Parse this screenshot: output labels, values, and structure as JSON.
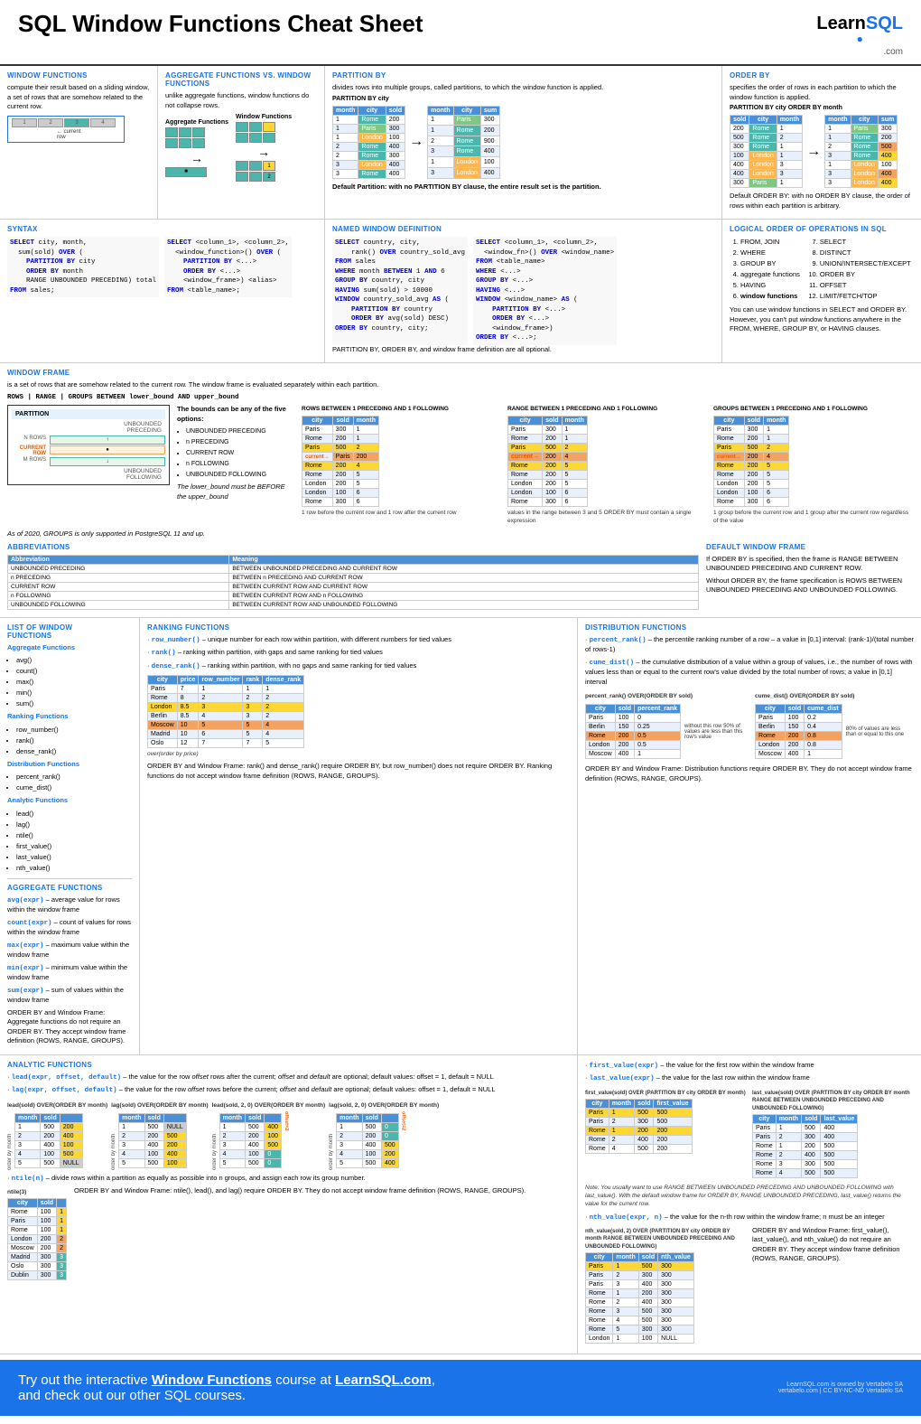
{
  "header": {
    "title": "SQL Window Functions Cheat Sheet",
    "logo_learn": "Learn",
    "logo_sql": "SQL",
    "logo_dot": "●",
    "logo_com": ".com"
  },
  "window_functions": {
    "title": "WINDOW FUNCTIONS",
    "desc": "compute their result based on a sliding window, a set of rows that are somehow related to the current row.",
    "label_current": "current",
    "label_row": "row"
  },
  "agg_vs_window": {
    "title": "AGGREGATE FUNCTIONS VS. WINDOW FUNCTIONS",
    "desc": "unlike aggregate functions, window functions do not collapse rows.",
    "label_agg": "Aggregate Functions",
    "label_win": "Window Functions"
  },
  "partition_by": {
    "title": "PARTITION BY",
    "desc": "divides rows into multiple groups, called partitions, to which the window function is applied.",
    "label_partition": "PARTITION BY city",
    "default_text": "Default Partition: with no PARTITION BY clause, the entire result set is the partition.",
    "table_headers": [
      "month",
      "city",
      "sold"
    ],
    "table_data": [
      [
        "1",
        "Rome",
        "200"
      ],
      [
        "1",
        "Paris",
        "300"
      ],
      [
        "1",
        "London",
        "100"
      ],
      [
        "2",
        "Rome",
        "400"
      ],
      [
        "2",
        "Rome",
        "300"
      ],
      [
        "3",
        "London",
        "400"
      ],
      [
        "3",
        "Rome",
        "400"
      ]
    ],
    "table2_headers": [
      "month",
      "city",
      "sum"
    ],
    "table2_data": [
      [
        "1",
        "Paris",
        "300"
      ],
      [
        "1",
        "Rome",
        "200"
      ],
      [
        "1",
        "London",
        "100"
      ],
      [
        "2",
        "Rome",
        "900"
      ],
      [
        "3",
        "London",
        "400"
      ],
      [
        "3",
        "Rome",
        "400"
      ]
    ]
  },
  "order_by": {
    "title": "ORDER BY",
    "desc": "specifies the order of rows in each partition to which the window function is applied.",
    "label": "PARTITION BY city ORDER BY month",
    "default_text": "Default ORDER BY: with no ORDER BY clause, the order of rows within each partition is arbitrary.",
    "table_headers": [
      "sold",
      "city",
      "month"
    ],
    "table_data": [
      [
        "200",
        "Rome",
        "1"
      ],
      [
        "500",
        "Rome",
        "2"
      ],
      [
        "300",
        "Rome",
        "1"
      ],
      [
        "100",
        "London",
        "1"
      ],
      [
        "400",
        "London",
        "3"
      ],
      [
        "400",
        "London",
        "3"
      ],
      [
        "300",
        "Paris",
        "1"
      ]
    ],
    "table2_headers": [
      "month",
      "city",
      "sum"
    ],
    "table2_data": [
      [
        "1",
        "Paris",
        "300"
      ],
      [
        "1",
        "Rome",
        "200"
      ],
      [
        "2",
        "Rome",
        "500"
      ],
      [
        "3",
        "Rome",
        "400"
      ],
      [
        "1",
        "London",
        "100"
      ],
      [
        "3",
        "London",
        "400"
      ],
      [
        "3",
        "London",
        "400"
      ]
    ]
  },
  "syntax": {
    "title": "SYNTAX",
    "code1": "SELECT city, month,\n  sum(sold) OVER (\n    PARTITION BY city\n    ORDER BY month\n    RANGE UNBOUNDED PRECEDING) total\nFROM sales;",
    "code2": "SELECT <column_1>, <column_2>,\n  <window_function>() OVER (\n    PARTITION BY <...>\n    ORDER BY <...>\n    <window_frame>) <window_column_alias>\nFROM <table_name>;"
  },
  "named_window": {
    "title": "Named Window Definition",
    "code1": "SELECT country, city,\n    rank() OVER country_sold_avg\nFROM sales\nWHERE month BETWEEN 1 AND 6\nGROUP BY country, city\nHAVING sum(sold) > 10000\nWINDOW country_sold_avg AS (\n    PARTITION BY country\n    ORDER BY avg(sold) DESC)\nORDER BY country, city;",
    "code2": "SELECT <column_1>, <column_2>,\n  <window_function>() OVER <window_name>\nFROM <table_name>\nWHERE <...>\nGROUP BY <...>\nHAVING <...>\nWINDOW <window_name> AS (\n    PARTITION BY <...>\n    ORDER BY <...>\n    <window_frame>)\nORDER BY <...>;",
    "note": "PARTITION BY, ORDER BY, and window frame definition are all optional."
  },
  "logical_order": {
    "title": "LOGICAL ORDER OF OPERATIONS IN SQL",
    "items_left": [
      "1.  FROM, JOIN",
      "2.  WHERE",
      "3.  GROUP BY",
      "4.  aggregate functions",
      "5.  HAVING",
      "6.  window functions"
    ],
    "items_right": [
      "7.  SELECT",
      "8.  DISTINCT",
      "9.  UNION/INTERSECT/EXCEPT",
      "10. ORDER BY",
      "11. OFFSET",
      "12. LIMIT/FETCH/TOP"
    ],
    "note": "You can use window functions in SELECT and ORDER BY. However, you can't put window functions anywhere in the FROM, WHERE, GROUP BY, or HAVING clauses."
  },
  "window_frame": {
    "title": "WINDOW FRAME",
    "desc": "is a set of rows that are somehow related to the current row. The window frame is evaluated separately within each partition.",
    "formula": "ROWS | RANGE | GROUPS BETWEEN lower_bound AND upper_bound",
    "labels": {
      "partition": "PARTITION",
      "unbounded_preceding": "UNBOUNDED\nPRECEDING",
      "n_preceding": "N ROWS",
      "current_row": "CURRENT\nROW",
      "m_following": "M ROWS",
      "unbounded_following": "UNBOUNDED\nFOLLOWING"
    },
    "bounds_title": "The bounds can be any of the five options:",
    "bounds": [
      "UNBOUNDED PRECEDING",
      "n PRECEDING",
      "CURRENT ROW",
      "n FOLLOWING",
      "UNBOUNDED FOLLOWING"
    ],
    "lower_note": "The lower_bound must be BEFORE the upper_bound",
    "rows_example_title": "ROWS BETWEEN 1 PRECEDING AND 1 FOLLOWING",
    "range_example_title": "RANGE BETWEEN 1 PRECEDING AND 1 FOLLOWING",
    "groups_example_title": "GROUPS BETWEEN 1 PRECEDING AND 1 FOLLOWING",
    "rows_note": "1 row before the current row and 1 row after the current row",
    "range_note": "values in the range between 3 and 5 ORDER BY must contain a single expression",
    "groups_note": "1 group before the current row and 1 group after the current row regardless of the value",
    "postgresql_note": "As of 2020, GROUPS is only supported in PostgreSQL 11 and up."
  },
  "abbreviations": {
    "title": "ABBREVIATIONS",
    "headers": [
      "Abbreviation",
      "Meaning"
    ],
    "rows": [
      [
        "UNBOUNDED PRECEDING",
        "BETWEEN UNBOUNDED PRECEDING AND CURRENT ROW"
      ],
      [
        "n PRECEDING",
        "BETWEEN n PRECEDING AND CURRENT ROW"
      ],
      [
        "CURRENT ROW",
        "BETWEEN CURRENT ROW AND CURRENT ROW"
      ],
      [
        "n FOLLOWING",
        "BETWEEN CURRENT ROW AND n FOLLOWING"
      ],
      [
        "UNBOUNDED FOLLOWING",
        "BETWEEN CURRENT ROW AND UNBOUNDED FOLLOWING"
      ]
    ]
  },
  "default_window": {
    "title": "DEFAULT WINDOW FRAME",
    "text1": "If ORDER BY is specified, then the frame is RANGE BETWEEN UNBOUNDED PRECEDING AND CURRENT ROW.",
    "text2": "Without ORDER BY, the frame specification is ROWS BETWEEN UNBOUNDED PRECEDING AND UNBOUNDED FOLLOWING."
  },
  "list_window_functions": {
    "title": "LIST OF WINDOW FUNCTIONS",
    "agg_title": "Aggregate Functions",
    "agg_items": [
      "avg()",
      "count()",
      "max()",
      "min()",
      "sum()"
    ],
    "rank_title": "Ranking Functions",
    "rank_items": [
      "row_number()",
      "rank()",
      "dense_rank()"
    ],
    "dist_title": "Distribution Functions",
    "dist_items": [
      "percent_rank()",
      "cume_dist()"
    ],
    "analytic_title": "Analytic Functions",
    "analytic_items": [
      "lead()",
      "lag()",
      "ntile()",
      "first_value()",
      "last_value()",
      "nth_value()"
    ],
    "agg_fn_title": "AGGREGATE FUNCTIONS",
    "agg_fn_desc": [
      "avg(expr) – average value for rows within the window frame",
      "count(expr) – count of values for rows within the window frame",
      "max(expr) – maximum value within the window frame",
      "min(expr) – minimum value within the window frame",
      "sum(expr) – sum of values within the window frame"
    ],
    "order_note": "ORDER BY and Window Frame: Aggregate functions do not require an ORDER BY. They accept window frame definition (ROWS, RANGE, GROUPS)."
  },
  "ranking_functions": {
    "title": "RANKING FUNCTIONS",
    "items": [
      "row_number() – unique number for each row within partition, with different numbers for tied values",
      "rank() – ranking within partition, with gaps and same ranking for tied values",
      "dense_rank() – ranking within partition, with no gaps and same ranking for tied values"
    ],
    "table_headers": [
      "city",
      "price",
      "row_number",
      "rank",
      "dense_rank"
    ],
    "table_note": "order(order by price)",
    "table_data": [
      [
        "Paris",
        "7",
        "1",
        "1",
        "1"
      ],
      [
        "Rome",
        "8",
        "2",
        "2",
        "2"
      ],
      [
        "London",
        "8.5",
        "3",
        "3",
        "2"
      ],
      [
        "Berlin",
        "8.5",
        "4",
        "3",
        "2"
      ],
      [
        "Moscow",
        "10",
        "5",
        "5",
        "4"
      ],
      [
        "Madrid",
        "10",
        "6",
        "5",
        "4"
      ],
      [
        "Oslo",
        "12",
        "7",
        "7",
        "5"
      ]
    ],
    "order_note": "ORDER BY and Window Frame: rank() and dense_rank() require ORDER BY, but row_number() does not require ORDER BY. Ranking functions do not accept window frame definition (ROWS, RANGE, GROUPS)."
  },
  "distribution_functions": {
    "title": "DISTRIBUTION FUNCTIONS",
    "percent_desc": "percent_rank() – the percentile ranking number of a row – a value in [0,1] interval: (rank-1)/(total number of rows-1)",
    "cume_desc": "cume_dist() – the cumulative distribution of a value within a group of values, i.e., the number of rows with values less than or equal to the current row's value divided by the total number of rows; a value in [0,1] interval",
    "percent_title": "percent_rank() OVER(ORDER BY sold)",
    "cume_title": "cume_dist() OVER(ORDER BY sold)",
    "percent_headers": [
      "city",
      "sold",
      "percent_rank"
    ],
    "percent_data": [
      [
        "Paris",
        "100",
        "0"
      ],
      [
        "Berlin",
        "150",
        "0.25"
      ],
      [
        "Rome",
        "200",
        "0.5"
      ],
      [
        "London",
        "200",
        "0.5"
      ],
      [
        "Moscow",
        "400",
        "1"
      ]
    ],
    "cume_headers": [
      "city",
      "sold",
      "cume_dist"
    ],
    "cume_data": [
      [
        "Paris",
        "100",
        "0.2"
      ],
      [
        "Berlin",
        "150",
        "0.4"
      ],
      [
        "Rome",
        "200",
        "0.8"
      ],
      [
        "London",
        "200",
        "0.8"
      ],
      [
        "Moscow",
        "400",
        "1"
      ]
    ],
    "note_percent": "without this row 50% of values are less than this row's value",
    "note_cume": "80% of values are less than or equal to this one",
    "order_note": "ORDER BY and Window Frame: Distribution functions require ORDER BY. They do not accept window frame definition (ROWS, RANGE, GROUPS)."
  },
  "analytic_functions": {
    "title": "ANALYTIC FUNCTIONS",
    "lead_desc": "lead(expr, offset, default) – the value for the row offset rows after the current; offset and default are optional; default values: offset = 1, default = NULL",
    "lag_desc": "lag(expr, offset, default) – the value for the row offset rows before the current; offset and default are optional; default values: offset = 1, default = NULL",
    "first_value_desc": "first_value(expr) – the value for the first row within the window frame",
    "last_value_desc": "last_value(expr) – the value for the last row within the window frame",
    "lead_table_title": "lead(sold) OVER(ORDER BY month)",
    "lag_table_title": "lag(sold) OVER(ORDER BY month)",
    "lead2_table_title": "lead(sold, 2, 0) OVER(ORDER BY month)",
    "lag2_table_title": "lag(sold, 2, 0) OVER(ORDER BY month)",
    "lead_headers": [
      "month",
      "sold",
      ""
    ],
    "lead_data": [
      [
        "1",
        "500",
        "200"
      ],
      [
        "2",
        "200",
        "400"
      ],
      [
        "3",
        "400",
        "100"
      ],
      [
        "4",
        "100",
        "500"
      ],
      [
        "5",
        "500",
        "NULL"
      ]
    ],
    "lag_data": [
      [
        "1",
        "500",
        "NULL"
      ],
      [
        "2",
        "200",
        "500"
      ],
      [
        "3",
        "400",
        "200"
      ],
      [
        "4",
        "100",
        "400"
      ],
      [
        "5",
        "500",
        "100"
      ]
    ],
    "lead2_data": [
      [
        "1",
        "500",
        "400"
      ],
      [
        "2",
        "200",
        "100"
      ],
      [
        "3",
        "400",
        "500"
      ],
      [
        "4",
        "100",
        "0"
      ],
      [
        "5",
        "500",
        "0"
      ]
    ],
    "lag2_data": [
      [
        "1",
        "500",
        "0"
      ],
      [
        "2",
        "200",
        "0"
      ],
      [
        "3",
        "400",
        "500"
      ],
      [
        "4",
        "100",
        "200"
      ],
      [
        "5",
        "500",
        "400"
      ]
    ],
    "first_value_title": "first_value(sold) OVER (PARTITION BY city ORDER BY month)",
    "last_value_title": "last_value(sold) OVER (PARTITION BY city ORDER BY month RANGE BETWEEN UNBOUNDED PRECEDING AND UNBOUNDED FOLLOWING)",
    "first_value_headers": [
      "city",
      "month",
      "sold",
      "first_value"
    ],
    "first_value_data": [
      [
        "Paris",
        "1",
        "500",
        "500"
      ],
      [
        "Paris",
        "2",
        "300",
        "500"
      ],
      [
        "Rome",
        "1",
        "200",
        "200"
      ],
      [
        "Rome",
        "2",
        "400",
        "200"
      ],
      [
        "Rome",
        "4",
        "500",
        "200"
      ]
    ],
    "last_value_headers": [
      "city",
      "month",
      "sold",
      "last_value"
    ],
    "last_value_data": [
      [
        "Paris",
        "1",
        "500",
        "400"
      ],
      [
        "Paris",
        "2",
        "300",
        "400"
      ],
      [
        "Rome",
        "1",
        "200",
        "500"
      ],
      [
        "Rome",
        "2",
        "400",
        "500"
      ],
      [
        "Rome",
        "3",
        "300",
        "500"
      ],
      [
        "Rome",
        "4",
        "500",
        "500"
      ]
    ],
    "ntile_desc": "ntile(n) – divide rows within a partition as equally as possible into n groups, and assign each row its group number.",
    "ntile_table_title": "ntile(3)",
    "ntile_headers": [
      "city",
      "sold",
      ""
    ],
    "ntile_data": [
      [
        "Rome",
        "100",
        "1"
      ],
      [
        "Paris",
        "100",
        "1"
      ],
      [
        "Rome",
        "100",
        "1"
      ],
      [
        "London",
        "200",
        "2"
      ],
      [
        "Moscow",
        "200",
        "2"
      ],
      [
        "Madrid",
        "300",
        "3"
      ],
      [
        "Oslo",
        "300",
        "3"
      ],
      [
        "Dublin",
        "300",
        "3"
      ]
    ],
    "nth_value_desc": "nth_value(expr, n) – the value for the n-th row within the window frame; n must be an integer",
    "nth_value_title": "nth_value(sold, 2) OVER (PARTITION BY city ORDER BY month RANGE BETWEEN UNBOUNDED PRECEDING AND UNBOUNDED FOLLOWING)",
    "nth_value_headers": [
      "city",
      "month",
      "sold",
      "nth_value"
    ],
    "nth_value_data": [
      [
        "Paris",
        "1",
        "500",
        "300"
      ],
      [
        "Paris",
        "2",
        "300",
        "300"
      ],
      [
        "Paris",
        "3",
        "400",
        "300"
      ],
      [
        "Rome",
        "1",
        "200",
        "300"
      ],
      [
        "Rome",
        "2",
        "400",
        "300"
      ],
      [
        "Rome",
        "3",
        "500",
        "300"
      ],
      [
        "Rome",
        "4",
        "500",
        "300"
      ],
      [
        "Rome",
        "5",
        "300",
        "300"
      ],
      [
        "London",
        "1",
        "100",
        "NULL"
      ]
    ],
    "order_note_analytic": "ORDER BY and Window Frame: ntile(), lead(), and lag() require ORDER BY. They do not accept window frame definition (ROWS, RANGE, GROUPS).",
    "order_note_fv": "ORDER BY and Window Frame: first_value(), last_value(), and nth_value() do not require an ORDER BY. They accept window frame definition (ROWS, RANGE, GROUPS).",
    "note_last_value": "Note: You usually want to use RANGE BETWEEN UNBOUNDED PRECEDING AND UNBOUNDED FOLLOWING with last_value(). With the default window frame for ORDER BY, RANGE UNBOUNDED PRECEDING, last_value() returns the value for the current row."
  },
  "footer": {
    "text_before": "Try out the interactive ",
    "link_wf": "Window Functions",
    "text_mid": " course at ",
    "link_learnsql": "LearnSQL.com",
    "text_after": ",",
    "line2": "and check out our other SQL courses.",
    "copy": "LearnSQL.com is owned by Vertabelo SA",
    "copy2": "vertabelo.com | CC BY-NC-ND Vertabelo SA"
  }
}
